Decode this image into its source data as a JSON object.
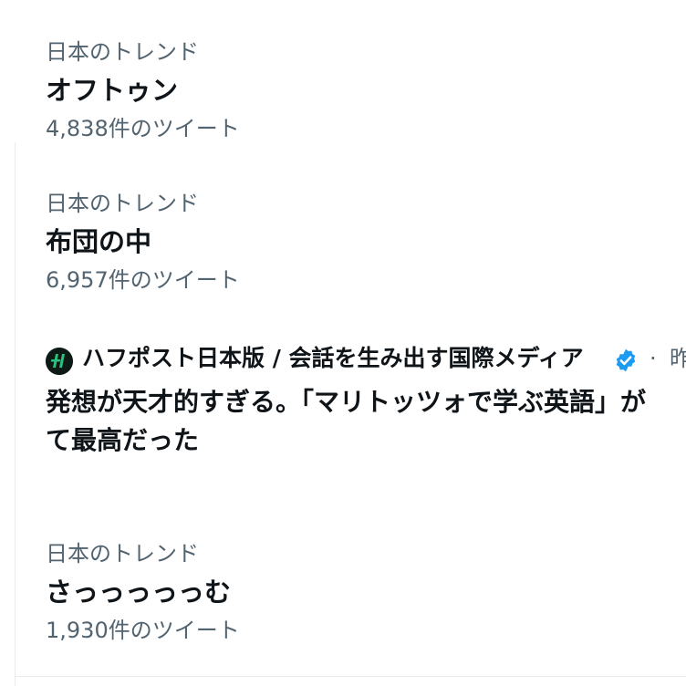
{
  "trends": [
    {
      "context": "日本のトレンド",
      "name": "オフトゥン",
      "count": "4,838件のツイート"
    },
    {
      "context": "日本のトレンド",
      "name": "布団の中",
      "count": "6,957件のツイート"
    },
    {
      "context": "日本のトレンド",
      "name": "さっっっっっむ",
      "count": "1,930件のツイート"
    }
  ],
  "promoted": {
    "account_name": "ハフポスト日本版 / 会話を生み出す国際メディア",
    "verified_icon": "verified-badge-icon",
    "separator": "·",
    "timestamp": "昨",
    "text_line1": "発想が天才的すぎる。「マリトッツォで学ぶ英語」が",
    "text_line2": "て最高だった"
  },
  "colors": {
    "primary_text": "#0f1419",
    "secondary_text": "#536471",
    "verified": "#1d9bf0",
    "divider": "#e9ecef"
  }
}
